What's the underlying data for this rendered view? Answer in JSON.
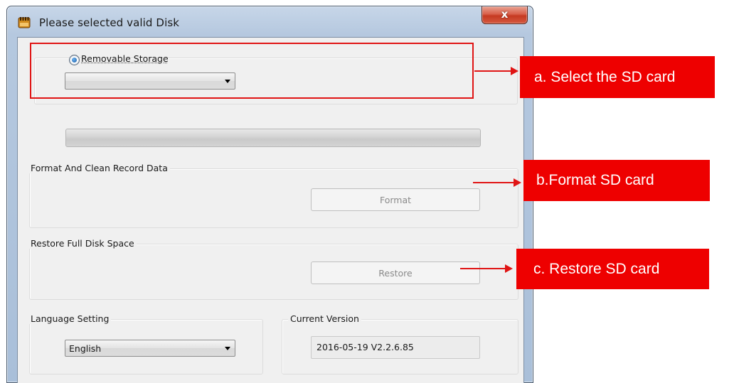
{
  "window": {
    "title": "Please selected valid Disk",
    "close_label": "x"
  },
  "storage": {
    "radio_label": "Removable Storage",
    "radio_selected": true,
    "disk_selected": ""
  },
  "progress": {
    "value": 0
  },
  "format_group": {
    "label": "Format And Clean Record Data",
    "button_label": "Format"
  },
  "restore_group": {
    "label": "Restore Full Disk Space",
    "button_label": "Restore"
  },
  "language_group": {
    "label": "Language Setting",
    "selected": "English"
  },
  "version_group": {
    "label": "Current Version",
    "value": "2016-05-19 V2.2.6.85"
  },
  "annotations": {
    "a": "a. Select the SD card",
    "b": "b.Format SD card",
    "c": "c. Restore SD card",
    "color": "#ee0000"
  },
  "icons": {
    "app": "sd-card-icon",
    "close": "close-icon",
    "dropdown": "chevron-down-icon"
  }
}
